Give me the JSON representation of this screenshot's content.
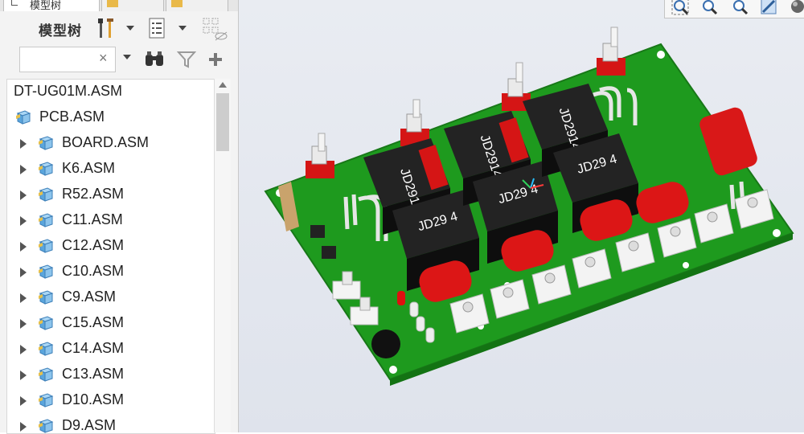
{
  "tabs": [
    {
      "label": "模型树"
    },
    {
      "label": ""
    },
    {
      "label": ""
    }
  ],
  "toolbar": {
    "title": "模型树",
    "icons": [
      "settings-icon",
      "dropdown-arrow-icon",
      "tree-columns-icon",
      "dropdown-arrow-icon",
      "hide-filter-icon"
    ]
  },
  "search": {
    "value": "",
    "placeholder": "",
    "clear_symbol": "×"
  },
  "search_icons": [
    "find-binoculars-icon",
    "filter-icon",
    "add-icon"
  ],
  "tree": {
    "root": "DT-UG01M.ASM",
    "items": [
      {
        "label": "PCB.ASM",
        "expandable": false
      },
      {
        "label": "BOARD.ASM",
        "expandable": true
      },
      {
        "label": "K6.ASM",
        "expandable": true
      },
      {
        "label": "R52.ASM",
        "expandable": true
      },
      {
        "label": "C11.ASM",
        "expandable": true
      },
      {
        "label": "C12.ASM",
        "expandable": true
      },
      {
        "label": "C10.ASM",
        "expandable": true
      },
      {
        "label": "C9.ASM",
        "expandable": true
      },
      {
        "label": "C15.ASM",
        "expandable": true
      },
      {
        "label": "C14.ASM",
        "expandable": true
      },
      {
        "label": "C13.ASM",
        "expandable": true
      },
      {
        "label": "D10.ASM",
        "expandable": true
      },
      {
        "label": "D9.ASM",
        "expandable": true
      }
    ]
  },
  "view_toolbar": [
    "zoom-refit-icon",
    "zoom-in-icon",
    "zoom-out-icon",
    "repaint-icon",
    "display-style-icon"
  ],
  "pcb": {
    "relay_labels": [
      "JD2914",
      "JD29 4"
    ],
    "colors": {
      "board": "#1e9a1e",
      "relay": "#1a1a1a",
      "capacitor": "#e01616",
      "terminal": "#f2f2f2"
    }
  }
}
